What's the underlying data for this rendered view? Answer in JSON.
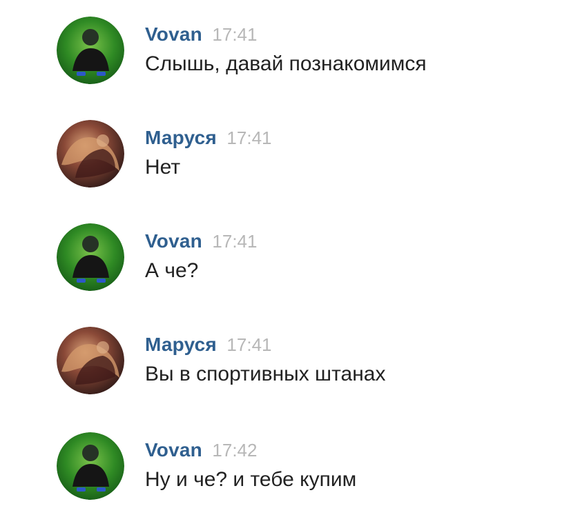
{
  "messages": [
    {
      "author": "Vovan",
      "time": "17:41",
      "text": "Слышь, давай познакомимся",
      "avatar_icon": "user-avatar-green-icon"
    },
    {
      "author": "Маруся",
      "time": "17:41",
      "text": "Нет",
      "avatar_icon": "user-avatar-warm-icon"
    },
    {
      "author": "Vovan",
      "time": "17:41",
      "text": "А че?",
      "avatar_icon": "user-avatar-green-icon"
    },
    {
      "author": "Маруся",
      "time": "17:41",
      "text": "Вы в спортивных штанах",
      "avatar_icon": "user-avatar-warm-icon"
    },
    {
      "author": "Vovan",
      "time": "17:42",
      "text": "Ну и че? и тебе купим",
      "avatar_icon": "user-avatar-green-icon"
    }
  ],
  "colors": {
    "author": "#2f5f8f",
    "time": "#b7b7b7",
    "text": "#222222",
    "background": "#ffffff"
  }
}
